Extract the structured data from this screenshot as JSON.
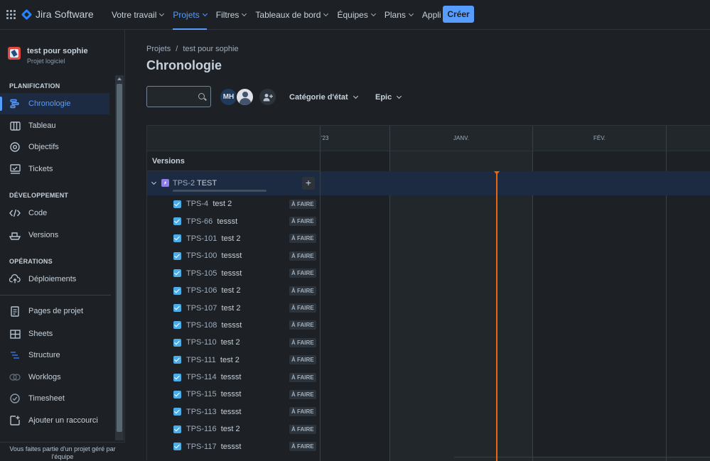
{
  "topnav": {
    "brand": "Jira Software",
    "items": [
      "Votre travail",
      "Projets",
      "Filtres",
      "Tableaux de bord",
      "Équipes",
      "Plans",
      "Appli"
    ],
    "active_index": 1,
    "create_label": "Créer"
  },
  "sidebar": {
    "project_name": "test pour sophie",
    "project_type": "Projet logiciel",
    "sections": {
      "planning": "PLANIFICATION",
      "development": "DÉVELOPPEMENT",
      "operations": "OPÉRATIONS"
    },
    "planning_items": [
      "Chronologie",
      "Tableau",
      "Objectifs",
      "Tickets"
    ],
    "dev_items": [
      "Code",
      "Versions"
    ],
    "ops_items": [
      "Déploiements"
    ],
    "extra_items": [
      "Pages de projet",
      "Sheets",
      "Structure",
      "Worklogs",
      "Timesheet",
      "Ajouter un raccourci"
    ],
    "footer": "Vous faites partie d'un projet géré par l'équipe"
  },
  "main": {
    "breadcrumb": [
      "Projets",
      "/",
      "test pour sophie"
    ],
    "title": "Chronologie",
    "search_value": "",
    "avatar_initials": "MH",
    "filter_status": "Catégorie d'état",
    "filter_epic": "Epic"
  },
  "timeline": {
    "months": [
      "'23",
      "JANV.",
      "FÉV."
    ],
    "versions_label": "Versions",
    "epic": {
      "key": "TPS-2",
      "name": "TEST"
    },
    "status_label": "À FAIRE",
    "tasks": [
      {
        "key": "TPS-4",
        "summary": "test 2"
      },
      {
        "key": "TPS-66",
        "summary": "tessst"
      },
      {
        "key": "TPS-101",
        "summary": "test 2"
      },
      {
        "key": "TPS-100",
        "summary": "tessst"
      },
      {
        "key": "TPS-105",
        "summary": "tessst"
      },
      {
        "key": "TPS-106",
        "summary": "test 2"
      },
      {
        "key": "TPS-107",
        "summary": "test 2"
      },
      {
        "key": "TPS-108",
        "summary": "tessst"
      },
      {
        "key": "TPS-110",
        "summary": "test 2"
      },
      {
        "key": "TPS-111",
        "summary": "test 2"
      },
      {
        "key": "TPS-114",
        "summary": "tessst"
      },
      {
        "key": "TPS-115",
        "summary": "tessst"
      },
      {
        "key": "TPS-113",
        "summary": "tessst"
      },
      {
        "key": "TPS-116",
        "summary": "test 2"
      },
      {
        "key": "TPS-117",
        "summary": "tessst"
      }
    ]
  },
  "colors": {
    "accent": "#579dff",
    "today": "#e56910",
    "epic": "#8f7ee7",
    "task": "#4bade8"
  }
}
